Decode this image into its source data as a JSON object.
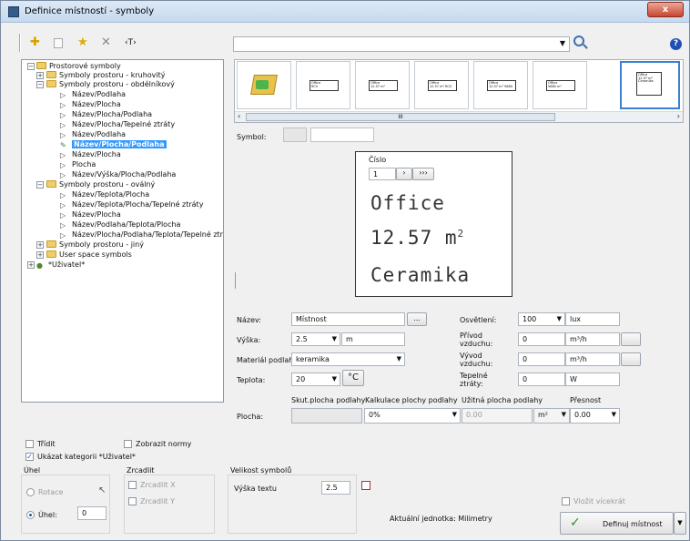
{
  "window": {
    "title": "Definice místností - symboly",
    "close_label": "x"
  },
  "toolbar": {
    "add_icon": "✚",
    "star_icon": "★",
    "delete_icon": "✕",
    "text_icon": "‹T›",
    "search_value": "",
    "help_icon": "?"
  },
  "tree": {
    "root": "Prostorové symboly",
    "circular": "Symboly prostoru - kruhovitý",
    "rect": "Symboly prostoru - obdélníkový",
    "rect_items": [
      "Název/Podlaha",
      "Název/Plocha",
      "Název/Plocha/Podlaha",
      "Název/Plocha/Tepelné ztráty",
      "Název/Podlaha",
      "Název/Plocha/Podlaha",
      "Název/Plocha",
      "Plocha",
      "Název/Výška/Plocha/Podlaha"
    ],
    "oval": "Symboly prostoru - oválný",
    "oval_items": [
      "Název/Teplota/Plocha",
      "Název/Teplota/Plocha/Tepelné ztráty",
      "Název/Plocha",
      "Název/Podlaha/Teplota/Plocha",
      "Název/Plocha/Podlaha/Teplota/Tepelné ztráty"
    ],
    "other": "Symboly prostoru - jiný",
    "user_space": "User space symbols",
    "user": "*Uživatel*"
  },
  "thumbs": [
    {
      "l1": "Office",
      "l2": "RCV"
    },
    {
      "l1": "Office",
      "l2": "12.57 m²"
    },
    {
      "l1": "Office",
      "l2": "12.57 m² RCV"
    },
    {
      "l1": "Office",
      "l2": "12.57 m² 5680"
    },
    {
      "l1": "Office",
      "l2": "5680 m²"
    },
    {
      "l1": "Office",
      "l2": "12.57 m² Ceramika"
    }
  ],
  "scroll_mid": "III",
  "symbol": {
    "label": "Symbol:"
  },
  "preview": {
    "cislo_label": "Číslo",
    "cislo_value": "1",
    "next": "›",
    "last": "›››",
    "name": "Office",
    "area": "12.57 m",
    "area_sup": "2",
    "floor": "Ceramika"
  },
  "form": {
    "nazev_label": "Název:",
    "nazev_value": "Místnost",
    "browse": "...",
    "vyska_label": "Výška:",
    "vyska_value": "2.5",
    "vyska_unit": "m",
    "material_label": "Materiál podlahy:",
    "material_value": "keramika",
    "teplota_label": "Teplota:",
    "teplota_value": "20",
    "teplota_unit": "°C",
    "osvetleni_label": "Osvětlení:",
    "osvetleni_value": "100",
    "osvetleni_unit": "lux",
    "privod_label": "Přívod vzduchu:",
    "privod_value": "0",
    "privod_unit": "m³/h",
    "vyvod_label": "Vývod vzduchu:",
    "vyvod_value": "0",
    "vyvod_unit": "m³/h",
    "ztraty_label": "Tepelné ztráty:",
    "ztraty_value": "0",
    "ztraty_unit": "W",
    "skut_label": "Skut.plocha podlahy",
    "kalk_label": "Kalkulace plochy podlahy",
    "uzit_label": "Užitná plocha podlahy",
    "presnost_label": "Přesnost",
    "plocha_label": "Plocha:",
    "kalk_value": "0%",
    "uzit_value": "0.00",
    "uzit_unit": "m²",
    "presnost_value": "0.00"
  },
  "options": {
    "tridit": "Třídit",
    "zobrazit": "Zobrazit normy",
    "ukazat": "Ukázat kategorii *Uživatel*"
  },
  "uhel": {
    "title": "Úhel",
    "rotace": "Rotace",
    "uhel": "Úhel:",
    "uhel_value": "0"
  },
  "zrcadlit": {
    "title": "Zrcadlit",
    "x": "Zrcadlit X",
    "y": "Zrcadlit Y"
  },
  "velikost": {
    "title": "Velikost symbolů",
    "vyska": "Výška textu",
    "vyska_value": "2.5"
  },
  "jednotka": "Aktuální jednotka: Milimetry",
  "vlozit": "Vložit vícekrát",
  "definuj": "Definuj místnost",
  "colors": {
    "selection": "#3399ff",
    "accent": "#1d6fd1",
    "check": "#2e8b2e"
  }
}
